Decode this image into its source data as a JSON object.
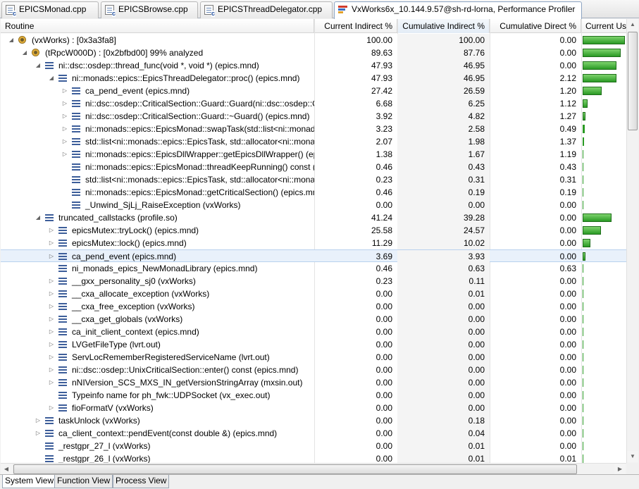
{
  "tabs": [
    {
      "label": "EPICSMonad.cpp",
      "icon": "cpp-file-icon",
      "active": false
    },
    {
      "label": "EPICSBrowse.cpp",
      "icon": "cpp-file-icon",
      "active": false
    },
    {
      "label": "EPICSThreadDelegator.cpp",
      "icon": "cpp-file-icon",
      "active": false
    },
    {
      "label": "VxWorks6x_10.144.9.57@sh-rd-lorna, Performance Profiler",
      "icon": "profiler-icon",
      "active": true,
      "close": "✕"
    }
  ],
  "columns": {
    "routine": "Routine",
    "current_indirect": "Current Indirect %",
    "cumulative_indirect": "Cumulative Indirect %",
    "cumulative_direct": "Cumulative Direct %",
    "current_usage": "Current Usa"
  },
  "rows": [
    {
      "level": 0,
      "expand": "open",
      "icon": "thread",
      "name": "(vxWorks) : [0x3a3fa8]",
      "ci": "100.00",
      "cumi": "100.00",
      "cumd": "0.00",
      "usage": 100
    },
    {
      "level": 1,
      "expand": "open",
      "icon": "thread",
      "name": "(tRpcW000D) : [0x2bfbd00] 99% analyzed",
      "ci": "89.63",
      "cumi": "87.76",
      "cumd": "0.00",
      "usage": 89.6
    },
    {
      "level": 2,
      "expand": "open",
      "icon": "function",
      "name": "ni::dsc::osdep::thread_func(void *, void *) (epics.mnd)",
      "ci": "47.93",
      "cumi": "46.95",
      "cumd": "0.00",
      "usage": 80
    },
    {
      "level": 3,
      "expand": "open",
      "icon": "function",
      "name": "ni::monads::epics::EpicsThreadDelegator::proc() (epics.mnd)",
      "ci": "47.93",
      "cumi": "46.95",
      "cumd": "2.12",
      "usage": 80
    },
    {
      "level": 4,
      "expand": "closed",
      "icon": "function",
      "name": "ca_pend_event (epics.mnd)",
      "ci": "27.42",
      "cumi": "26.59",
      "cumd": "1.20",
      "usage": 45
    },
    {
      "level": 4,
      "expand": "closed",
      "icon": "function",
      "name": "ni::dsc::osdep::CriticalSection::Guard::Guard(ni::dsc::osdep::Cr",
      "ci": "6.68",
      "cumi": "6.25",
      "cumd": "1.12",
      "usage": 11
    },
    {
      "level": 4,
      "expand": "closed",
      "icon": "function",
      "name": "ni::dsc::osdep::CriticalSection::Guard::~Guard() (epics.mnd)",
      "ci": "3.92",
      "cumi": "4.82",
      "cumd": "1.27",
      "usage": 6.5
    },
    {
      "level": 4,
      "expand": "closed",
      "icon": "function",
      "name": "ni::monads::epics::EpicsMonad::swapTask(std::list<ni::monad",
      "ci": "3.23",
      "cumi": "2.58",
      "cumd": "0.49",
      "usage": 5.4
    },
    {
      "level": 4,
      "expand": "closed",
      "icon": "function",
      "name": "std::list<ni::monads::epics::EpicsTask, std::allocator<ni::mona",
      "ci": "2.07",
      "cumi": "1.98",
      "cumd": "1.37",
      "usage": 3.5
    },
    {
      "level": 4,
      "expand": "closed",
      "icon": "function",
      "name": "ni::monads::epics::EpicsDllWrapper::getEpicsDllWrapper() (epi",
      "ci": "1.38",
      "cumi": "1.67",
      "cumd": "1.19",
      "usage": 2.3
    },
    {
      "level": 4,
      "expand": "none",
      "icon": "function",
      "name": "ni::monads::epics::EpicsMonad::threadKeepRunning() const (e",
      "ci": "0.46",
      "cumi": "0.43",
      "cumd": "0.43",
      "usage": 0.8
    },
    {
      "level": 4,
      "expand": "none",
      "icon": "function",
      "name": "std::list<ni::monads::epics::EpicsTask, std::allocator<ni::mona",
      "ci": "0.23",
      "cumi": "0.31",
      "cumd": "0.31",
      "usage": 0.4
    },
    {
      "level": 4,
      "expand": "none",
      "icon": "function",
      "name": "ni::monads::epics::EpicsMonad::getCriticalSection() (epics.mnd",
      "ci": "0.46",
      "cumi": "0.19",
      "cumd": "0.19",
      "usage": 0.8
    },
    {
      "level": 4,
      "expand": "none",
      "icon": "function",
      "name": "_Unwind_SjLj_RaiseException (vxWorks)",
      "ci": "0.00",
      "cumi": "0.00",
      "cumd": "0.00",
      "usage": 0
    },
    {
      "level": 2,
      "expand": "open",
      "icon": "function",
      "name": "truncated_callstacks (profile.so)",
      "ci": "41.24",
      "cumi": "39.28",
      "cumd": "0.00",
      "usage": 69
    },
    {
      "level": 3,
      "expand": "closed",
      "icon": "function",
      "name": "epicsMutex::tryLock() (epics.mnd)",
      "ci": "25.58",
      "cumi": "24.57",
      "cumd": "0.00",
      "usage": 43
    },
    {
      "level": 3,
      "expand": "closed",
      "icon": "function",
      "name": "epicsMutex::lock() (epics.mnd)",
      "ci": "11.29",
      "cumi": "10.02",
      "cumd": "0.00",
      "usage": 19
    },
    {
      "level": 3,
      "expand": "closed",
      "icon": "function",
      "name": "ca_pend_event (epics.mnd)",
      "ci": "3.69",
      "cumi": "3.93",
      "cumd": "0.00",
      "usage": 6.2,
      "selected": true
    },
    {
      "level": 3,
      "expand": "none",
      "icon": "function",
      "name": "ni_monads_epics_NewMonadLibrary (epics.mnd)",
      "ci": "0.46",
      "cumi": "0.63",
      "cumd": "0.63",
      "usage": 0.8
    },
    {
      "level": 3,
      "expand": "closed",
      "icon": "function",
      "name": "__gxx_personality_sj0 (vxWorks)",
      "ci": "0.23",
      "cumi": "0.11",
      "cumd": "0.00",
      "usage": 0.4
    },
    {
      "level": 3,
      "expand": "closed",
      "icon": "function",
      "name": "__cxa_allocate_exception (vxWorks)",
      "ci": "0.00",
      "cumi": "0.01",
      "cumd": "0.00",
      "usage": 0
    },
    {
      "level": 3,
      "expand": "closed",
      "icon": "function",
      "name": "__cxa_free_exception (vxWorks)",
      "ci": "0.00",
      "cumi": "0.00",
      "cumd": "0.00",
      "usage": 0
    },
    {
      "level": 3,
      "expand": "closed",
      "icon": "function",
      "name": "__cxa_get_globals (vxWorks)",
      "ci": "0.00",
      "cumi": "0.00",
      "cumd": "0.00",
      "usage": 0
    },
    {
      "level": 3,
      "expand": "closed",
      "icon": "function",
      "name": "ca_init_client_context (epics.mnd)",
      "ci": "0.00",
      "cumi": "0.00",
      "cumd": "0.00",
      "usage": 0
    },
    {
      "level": 3,
      "expand": "closed",
      "icon": "function",
      "name": "LVGetFileType (lvrt.out)",
      "ci": "0.00",
      "cumi": "0.00",
      "cumd": "0.00",
      "usage": 0
    },
    {
      "level": 3,
      "expand": "closed",
      "icon": "function",
      "name": "ServLocRememberRegisteredServiceName (lvrt.out)",
      "ci": "0.00",
      "cumi": "0.00",
      "cumd": "0.00",
      "usage": 0
    },
    {
      "level": 3,
      "expand": "closed",
      "icon": "function",
      "name": "ni::dsc::osdep::UnixCriticalSection::enter() const (epics.mnd)",
      "ci": "0.00",
      "cumi": "0.00",
      "cumd": "0.00",
      "usage": 0
    },
    {
      "level": 3,
      "expand": "closed",
      "icon": "function",
      "name": "nNIVersion_SCS_MXS_IN_getVersionStringArray (mxsin.out)",
      "ci": "0.00",
      "cumi": "0.00",
      "cumd": "0.00",
      "usage": 0
    },
    {
      "level": 3,
      "expand": "none",
      "icon": "function",
      "name": "Typeinfo name for ph_fwk::UDPSocket (vx_exec.out)",
      "ci": "0.00",
      "cumi": "0.00",
      "cumd": "0.00",
      "usage": 0
    },
    {
      "level": 3,
      "expand": "closed",
      "icon": "function",
      "name": "fioFormatV (vxWorks)",
      "ci": "0.00",
      "cumi": "0.00",
      "cumd": "0.00",
      "usage": 0
    },
    {
      "level": 2,
      "expand": "closed",
      "icon": "function",
      "name": "taskUnlock (vxWorks)",
      "ci": "0.00",
      "cumi": "0.18",
      "cumd": "0.00",
      "usage": 0
    },
    {
      "level": 2,
      "expand": "closed",
      "icon": "function",
      "name": "ca_client_context::pendEvent(const double &) (epics.mnd)",
      "ci": "0.00",
      "cumi": "0.04",
      "cumd": "0.00",
      "usage": 0
    },
    {
      "level": 2,
      "expand": "none",
      "icon": "function",
      "name": "_restgpr_27_l (vxWorks)",
      "ci": "0.00",
      "cumi": "0.01",
      "cumd": "0.00",
      "usage": 0
    },
    {
      "level": 2,
      "expand": "none",
      "icon": "function",
      "name": "_restgpr_26_l (vxWorks)",
      "ci": "0.00",
      "cumi": "0.01",
      "cumd": "0.01",
      "usage": 0
    }
  ],
  "view_tabs": [
    {
      "label": "System View",
      "active": true
    },
    {
      "label": "Function View",
      "active": false
    },
    {
      "label": "Process View",
      "active": false
    }
  ],
  "colors": {
    "usage_bar": "#2a9a24",
    "selection": "#e9f1fb",
    "function_icon": "#3d5e9a",
    "thread_icon": "#e8b23b"
  }
}
